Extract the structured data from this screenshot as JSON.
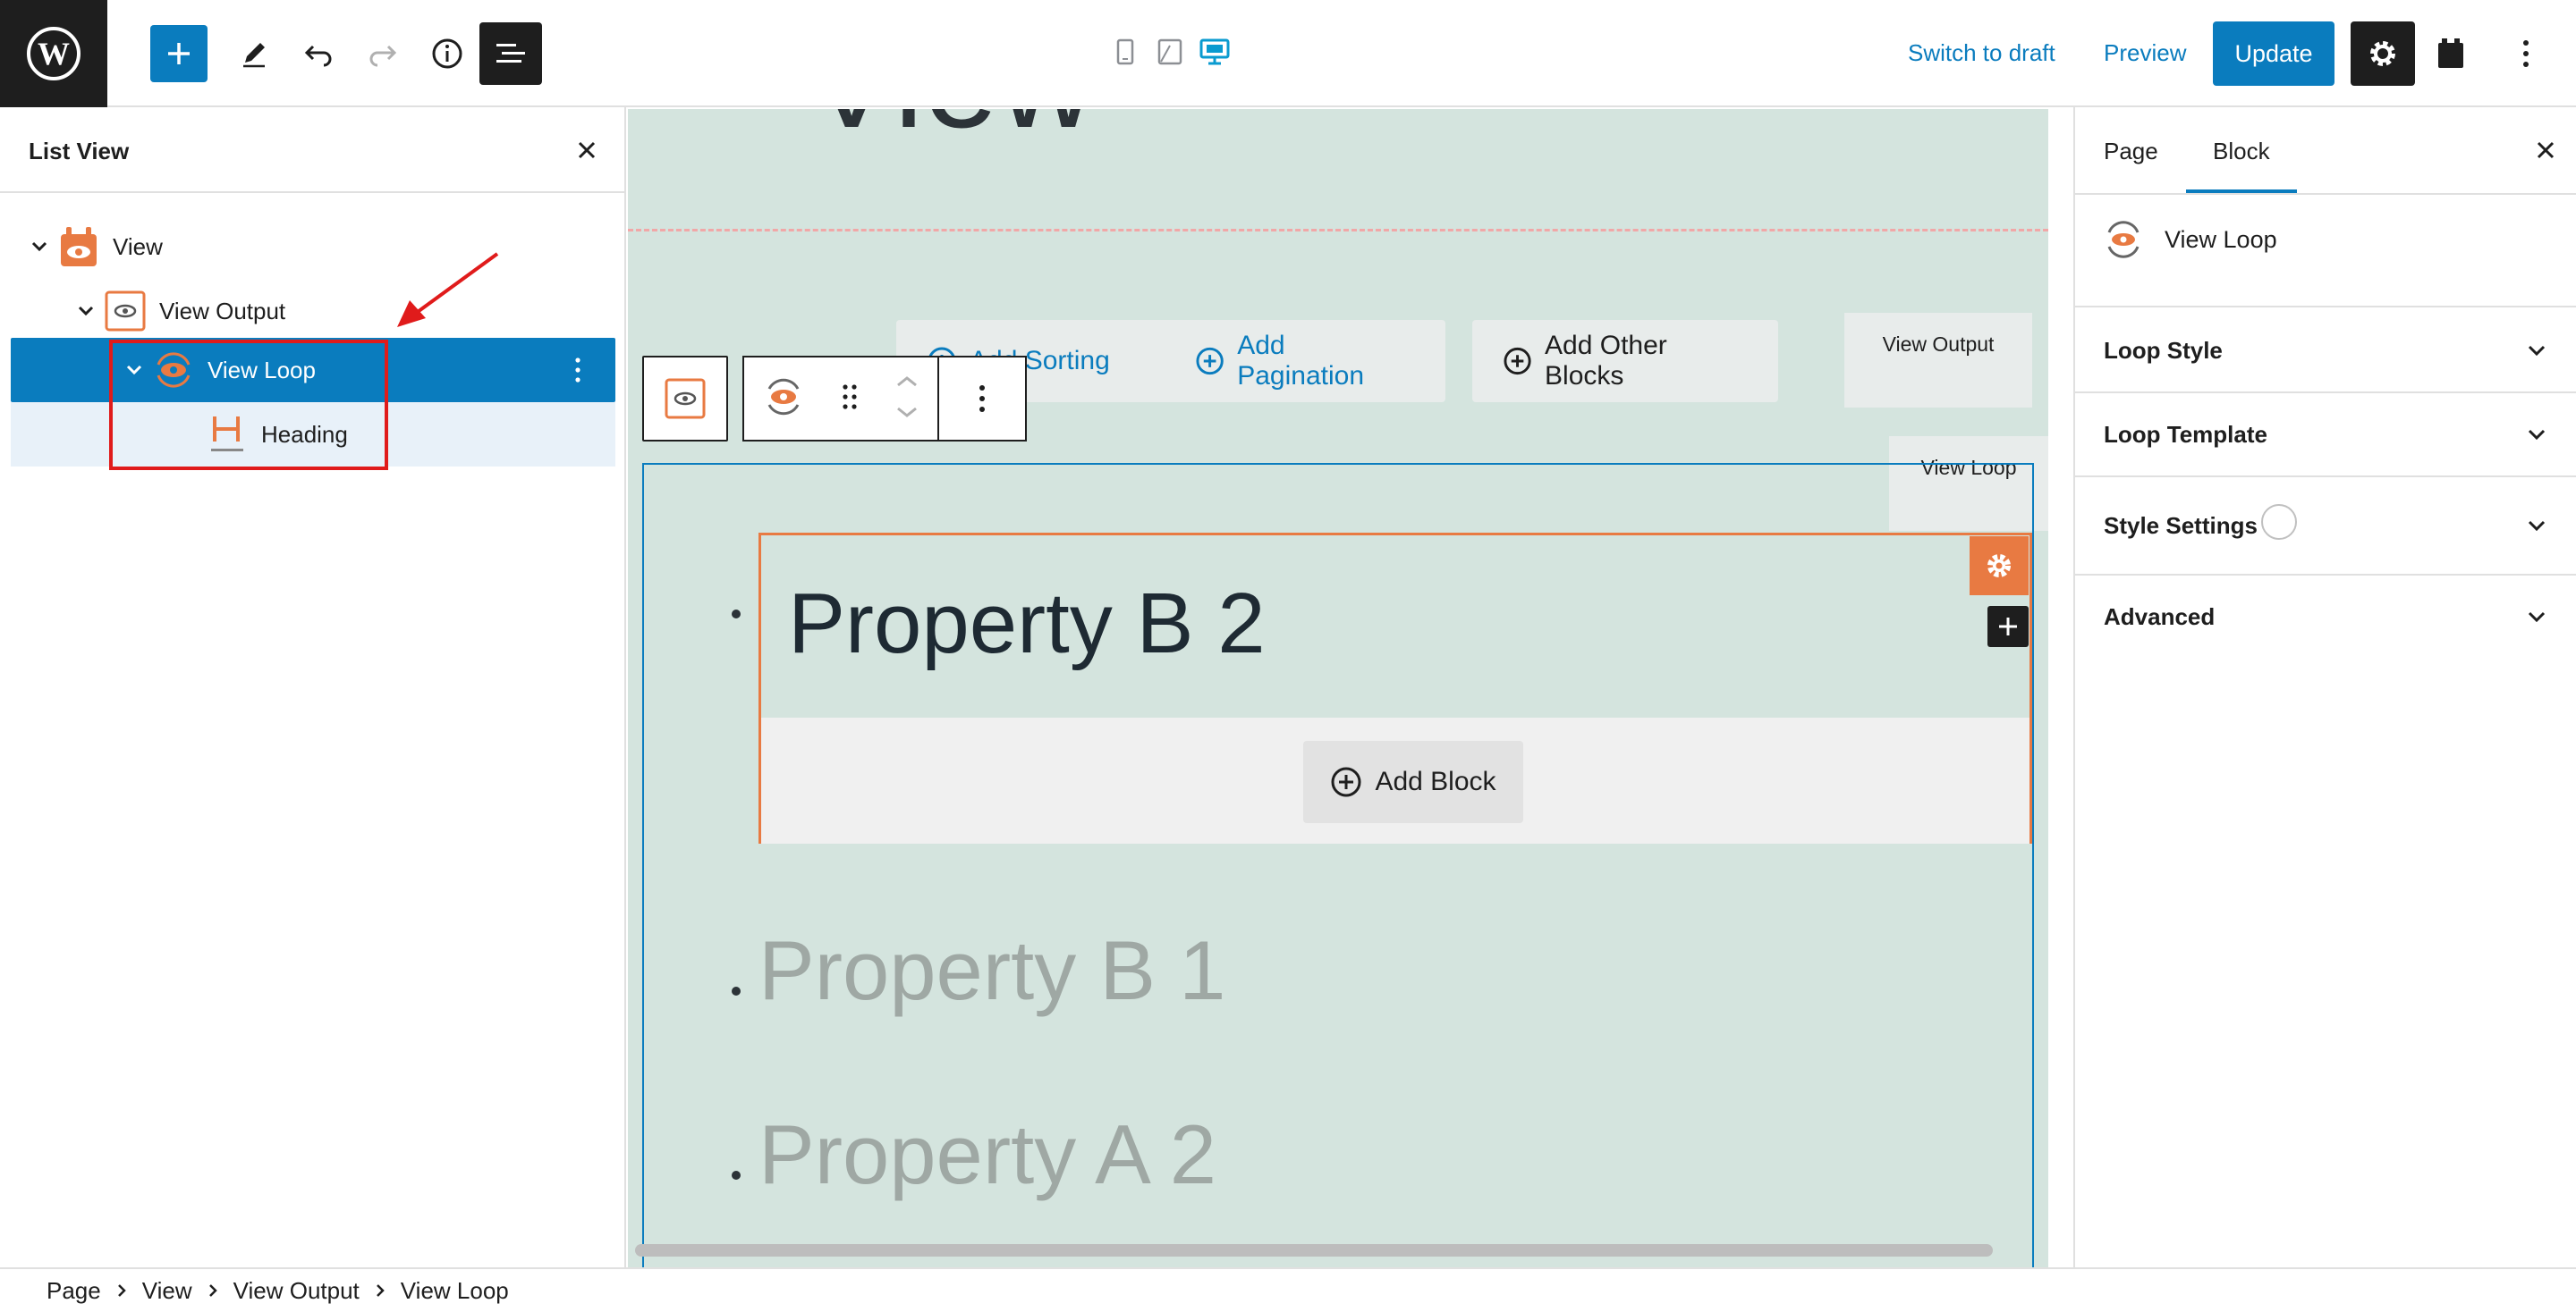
{
  "toolbar": {
    "switch_to_draft": "Switch to draft",
    "preview": "Preview",
    "update": "Update"
  },
  "list_view": {
    "title": "List View",
    "items": [
      {
        "label": "View"
      },
      {
        "label": "View Output"
      },
      {
        "label": "View Loop"
      },
      {
        "label": "Heading"
      }
    ]
  },
  "canvas": {
    "buttons": {
      "add_sorting": "Add Sorting",
      "add_pagination": "Add Pagination",
      "add_other_blocks": "Add Other Blocks"
    },
    "tags": {
      "view_output": "View Output",
      "view_loop": "View Loop"
    },
    "selected_item_heading": "Property B 2",
    "add_block": "Add Block",
    "other_items": [
      "Property B 1",
      "Property A 2"
    ]
  },
  "sidebar": {
    "tabs": [
      "Page",
      "Block"
    ],
    "active_tab": "Block",
    "block_name": "View Loop",
    "panels": [
      "Loop Style",
      "Loop Template",
      "Style Settings",
      "Advanced"
    ]
  },
  "breadcrumbs": [
    "Page",
    "View",
    "View Output",
    "View Loop"
  ],
  "colors": {
    "accent": "#0a7cbe",
    "plugin_orange": "#e87a42",
    "canvas_bg": "#d4e4de",
    "annotation_red": "#e01b1b"
  }
}
